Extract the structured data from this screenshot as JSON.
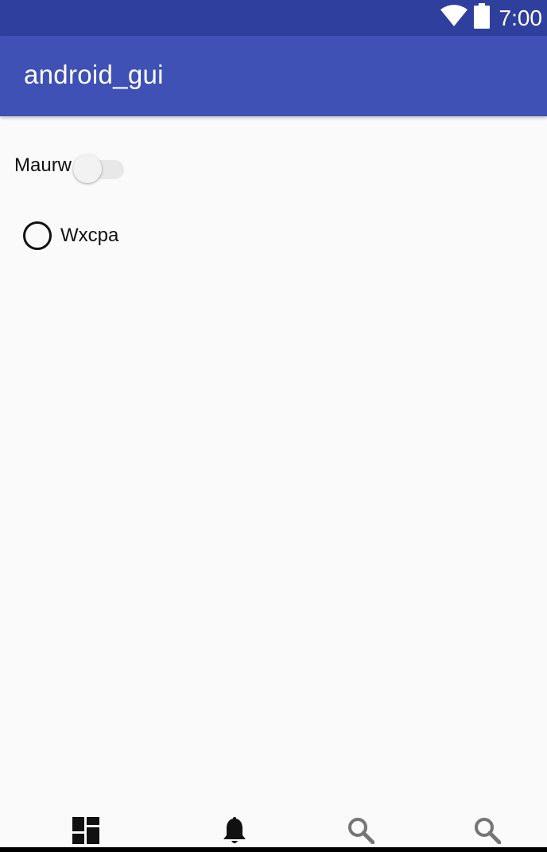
{
  "status_bar": {
    "time": "7:00",
    "icons": [
      "wifi-icon",
      "battery-icon"
    ]
  },
  "app_bar": {
    "title": "android_gui"
  },
  "content": {
    "switch": {
      "label": "Maurw",
      "checked": false
    },
    "radio": {
      "label": "Wxcpa",
      "checked": false
    }
  },
  "bottom_nav": {
    "items": [
      {
        "icon": "dashboard-icon"
      },
      {
        "icon": "notifications-icon"
      },
      {
        "icon": "search-icon"
      },
      {
        "icon": "search-icon"
      }
    ]
  },
  "colors": {
    "status_bar": "#2f3f9e",
    "app_bar": "#3f51b5",
    "background": "#fafafa"
  }
}
